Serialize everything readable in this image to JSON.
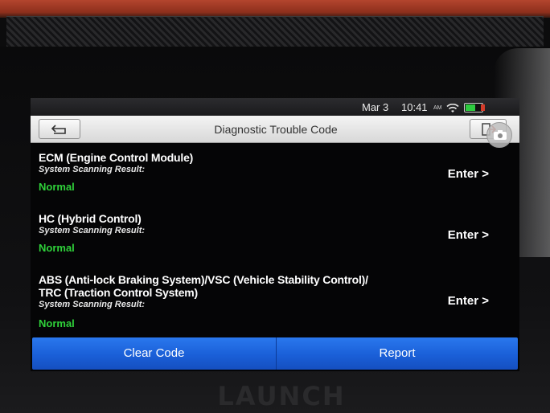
{
  "status_bar": {
    "date": "Mar 3",
    "time": "10:41",
    "ampm": "AM",
    "icons": [
      "wifi-icon",
      "battery-icon"
    ],
    "battery_color": "#2ecc40"
  },
  "header": {
    "title": "Diagnostic Trouble Code",
    "back_icon": "back-arrow-icon",
    "exit_icon": "exit-icon",
    "camera_icon": "camera-icon"
  },
  "systems": [
    {
      "name": "ECM (Engine Control Module)",
      "scan_label": "System Scanning Result:",
      "result": "Normal",
      "action": "Enter >"
    },
    {
      "name": "HC (Hybrid Control)",
      "scan_label": "System Scanning Result:",
      "result": "Normal",
      "action": "Enter >"
    },
    {
      "name_line1": "ABS (Anti-lock Braking System)/VSC (Vehicle Stability Control)/",
      "name_line2": "TRC (Traction Control System)",
      "scan_label": "System Scanning Result:",
      "result": "Normal",
      "action": "Enter >"
    }
  ],
  "actions": {
    "clear_code": "Clear Code",
    "report": "Report"
  },
  "device": {
    "brand": "LAUNCH"
  },
  "colors": {
    "result_normal": "#2fd13a",
    "action_bar": "#1a5fd8",
    "screen_bg": "#050506"
  }
}
